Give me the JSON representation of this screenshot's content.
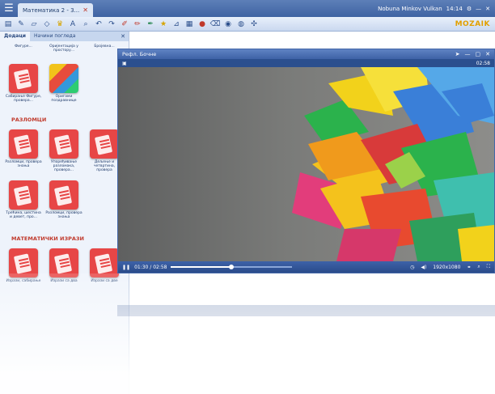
{
  "titlebar": {
    "tab_label": "Математика 2 - 3...",
    "user": "Nobuna Minkov Vulkan",
    "clock": "14:14"
  },
  "toolbar": {
    "brand_main": "MOZAIK",
    "icons": [
      "menu-icon",
      "layers-icon",
      "pen-icon",
      "eraser-icon",
      "shapes-icon",
      "text-icon",
      "zoom-icon",
      "undo-icon",
      "redo-icon",
      "marker-icon",
      "highlighter-icon",
      "crown-icon",
      "ruler-icon",
      "table-icon",
      "circle-icon",
      "trash-icon",
      "settings-icon",
      "camera-icon",
      "globe-icon"
    ]
  },
  "left_panel": {
    "tabs": [
      "Додаци",
      "Начини погледа"
    ],
    "top_items": [
      {
        "caption": "Фигуре..."
      },
      {
        "caption": "Оријентација у простору..."
      },
      {
        "caption": "Бројевна..."
      }
    ],
    "row_items": [
      {
        "caption": "Сабирање Фигуре, провера...",
        "photo": false
      },
      {
        "caption": "Оригами поздравнице",
        "photo": true
      }
    ],
    "section_1": "РАЗЛОМЦИ",
    "section_1_items": [
      {
        "caption": "Разломци, провера знања"
      },
      {
        "caption": "Упоређивање разломака, провера..."
      },
      {
        "caption": "Дељење и четвртина, провера"
      },
      {
        "caption": "Трећина, шестина и девет, про..."
      },
      {
        "caption": "Разломци, провера знања"
      }
    ],
    "section_2": "МАТЕМАТИЧКИ ИЗРАЗИ",
    "section_2_items": [
      {
        "caption": "Изрази, сабирање"
      },
      {
        "caption": "Изрази са два"
      },
      {
        "caption": "Изрази са две"
      }
    ]
  },
  "video_window": {
    "title": "Рефл. Бочне",
    "elapsed_top": "02:58",
    "time_label": "01:30 / 02:58",
    "progress": 0.5,
    "quality": "1920x1080"
  },
  "colors": {
    "accent": "#3f63a3",
    "section_red": "#c0392b"
  }
}
